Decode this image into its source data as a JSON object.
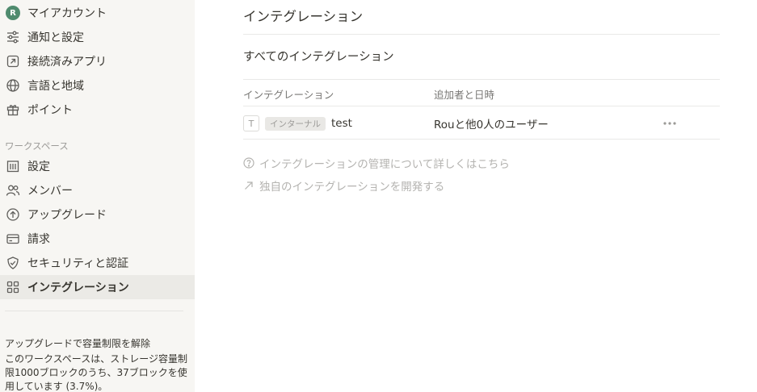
{
  "sidebar": {
    "items": [
      {
        "label": "マイアカウント",
        "icon": "avatar-icon",
        "avatar_letter": "R"
      },
      {
        "label": "通知と設定",
        "icon": "sliders-icon"
      },
      {
        "label": "接続済みアプリ",
        "icon": "arrow-square-icon"
      },
      {
        "label": "言語と地域",
        "icon": "globe-icon"
      },
      {
        "label": "ポイント",
        "icon": "gift-icon"
      }
    ],
    "workspace_label": "ワークスペース",
    "workspace_items": [
      {
        "label": "設定",
        "icon": "building-icon"
      },
      {
        "label": "メンバー",
        "icon": "people-icon"
      },
      {
        "label": "アップグレード",
        "icon": "arrow-up-circle-icon"
      },
      {
        "label": "請求",
        "icon": "card-icon"
      },
      {
        "label": "セキュリティと認証",
        "icon": "shield-check-icon"
      },
      {
        "label": "インテグレーション",
        "icon": "grid-icon",
        "active": true
      }
    ],
    "upgrade": {
      "title": "アップグレードで容量制限を解除",
      "body": "このワークスペースは、ストレージ容量制限1000ブロックのうち、37ブロックを使用しています (3.7%)。"
    }
  },
  "main": {
    "title": "インテグレーション",
    "section_title": "すべてのインテグレーション",
    "table": {
      "headers": [
        "インテグレーション",
        "追加者と日時"
      ],
      "rows": [
        {
          "icon_letter": "T",
          "badge": "インターナル",
          "name": "test",
          "added_by": "Rouと他0人のユーザー",
          "more": "•••"
        }
      ]
    },
    "links": {
      "learn_more": "インテグレーションの管理について詳しくはこちら",
      "develop": "独自のインテグレーションを開発する"
    }
  },
  "colors": {
    "sidebar_bg": "#f7f6f3",
    "active_bg": "#ebeae6",
    "avatar": "#4f8b6e",
    "text": "#37352f",
    "muted": "#9b9a97"
  }
}
